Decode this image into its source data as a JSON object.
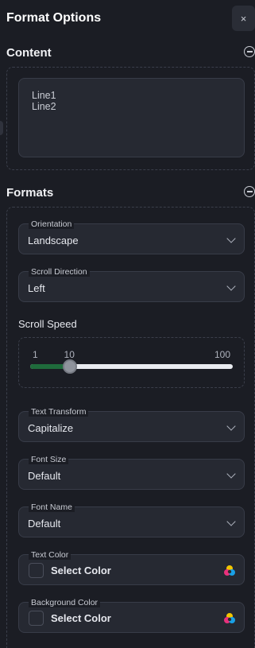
{
  "header": {
    "title": "Format Options",
    "close_label": "×"
  },
  "content": {
    "title": "Content",
    "text_value": "Line1\nLine2"
  },
  "formats": {
    "title": "Formats",
    "orientation": {
      "label": "Orientation",
      "value": "Landscape"
    },
    "scroll_direction": {
      "label": "Scroll Direction",
      "value": "Left"
    },
    "scroll_speed": {
      "label": "Scroll Speed",
      "min_label": "1",
      "max_label": "100",
      "value": 10,
      "min": 1,
      "max": 100
    },
    "text_transform": {
      "label": "Text Transform",
      "value": "Capitalize"
    },
    "font_size": {
      "label": "Font Size",
      "value": "Default"
    },
    "font_name": {
      "label": "Font Name",
      "value": "Default"
    },
    "text_color": {
      "label": "Text Color",
      "value": "Select Color"
    },
    "background_color": {
      "label": "Background Color",
      "value": "Select Color"
    }
  },
  "colors": {
    "accent": "#1f6b3c",
    "background": "#1b1d24",
    "panel": "#262932"
  },
  "icons": {
    "close": "close-icon",
    "collapse": "minus-circle-icon",
    "chevron": "chevron-down-icon",
    "palette": "palette-icon"
  }
}
